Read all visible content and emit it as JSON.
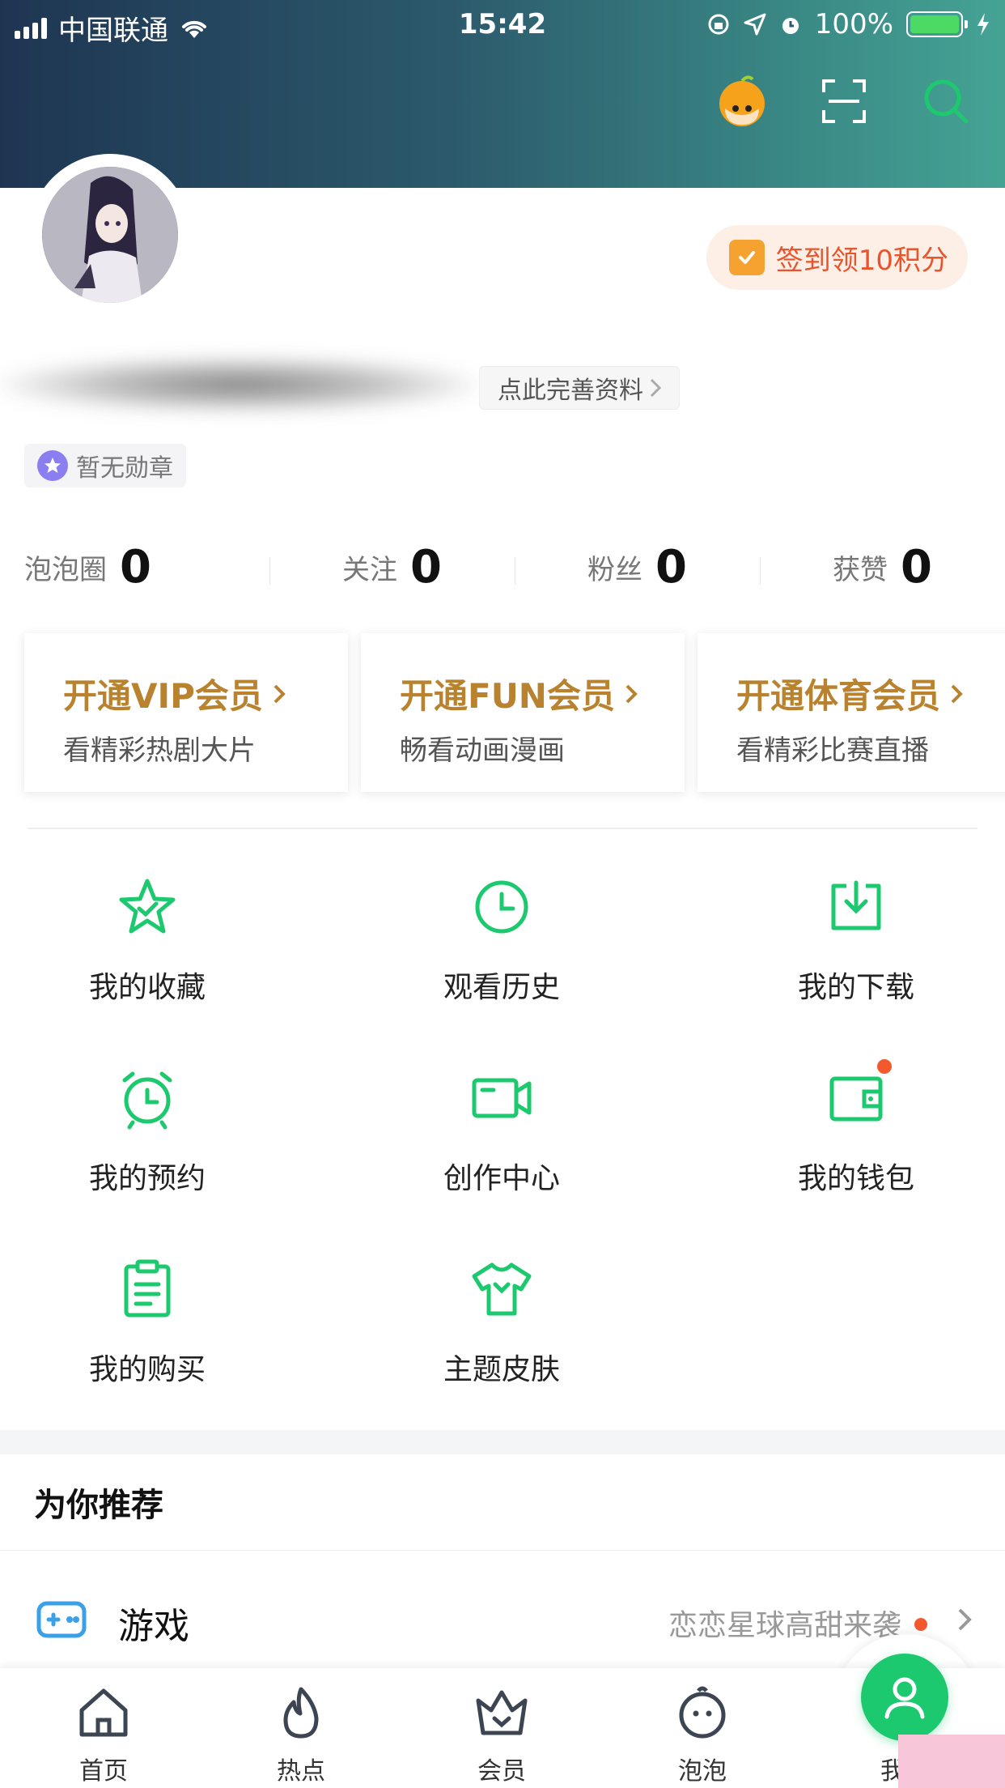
{
  "status_bar": {
    "carrier": "中国联通",
    "time": "15:42",
    "battery": "100%"
  },
  "profile": {
    "checkin_label": "签到领10积分",
    "complete_label": "点此完善资料",
    "badge_label": "暂无勋章"
  },
  "stats": [
    {
      "label": "泡泡圈",
      "value": "0"
    },
    {
      "label": "关注",
      "value": "0"
    },
    {
      "label": "粉丝",
      "value": "0"
    },
    {
      "label": "获赞",
      "value": "0"
    }
  ],
  "vip_cards": [
    {
      "title": "开通VIP会员",
      "subtitle": "看精彩热剧大片"
    },
    {
      "title": "开通FUN会员",
      "subtitle": "畅看动画漫画"
    },
    {
      "title": "开通体育会员",
      "subtitle": "看精彩比赛直播"
    }
  ],
  "grid": [
    {
      "label": "我的收藏",
      "icon": "star-icon"
    },
    {
      "label": "观看历史",
      "icon": "clock-icon"
    },
    {
      "label": "我的下载",
      "icon": "download-icon"
    },
    {
      "label": "我的预约",
      "icon": "alarm-clock-icon"
    },
    {
      "label": "创作中心",
      "icon": "video-camera-icon"
    },
    {
      "label": "我的钱包",
      "icon": "wallet-icon"
    },
    {
      "label": "我的购买",
      "icon": "clipboard-icon"
    },
    {
      "label": "主题皮肤",
      "icon": "tshirt-icon"
    }
  ],
  "recommend": {
    "title": "为你推荐",
    "game_label": "游戏",
    "game_promo": "恋恋星球高甜来袭"
  },
  "tabs": [
    {
      "label": "首页",
      "icon": "home-icon"
    },
    {
      "label": "热点",
      "icon": "flame-icon"
    },
    {
      "label": "会员",
      "icon": "crown-icon"
    },
    {
      "label": "泡泡",
      "icon": "bubble-face-icon"
    },
    {
      "label": "我",
      "icon": "user-icon"
    }
  ],
  "colors": {
    "accent_green": "#1dc96f",
    "vip_gold": "#b8822f",
    "checkin_orange": "#e8542c",
    "header_gradient_start": "#1e3552",
    "header_gradient_end": "#45a394"
  }
}
